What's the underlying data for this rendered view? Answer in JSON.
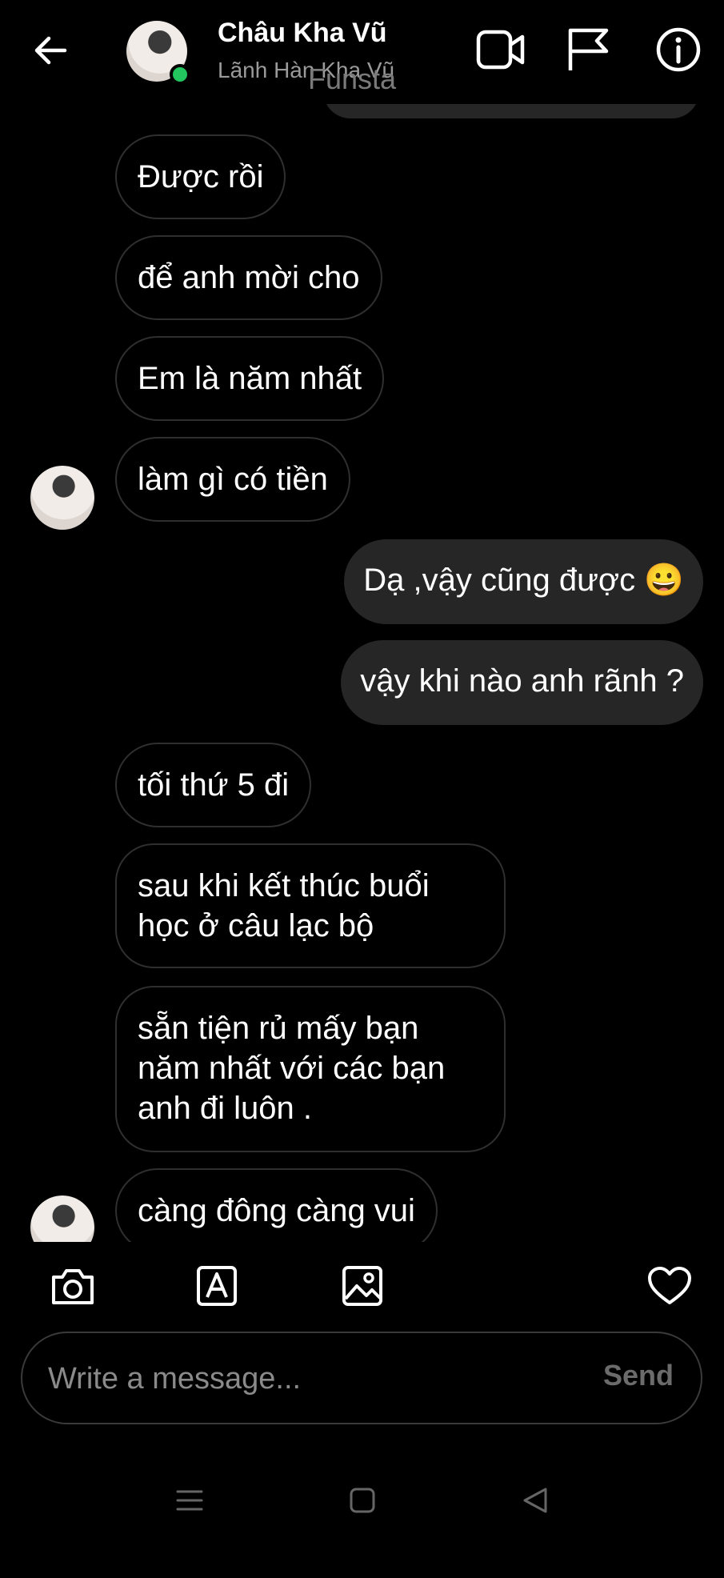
{
  "header": {
    "contact_name": "Châu Kha Vũ",
    "contact_subtitle": "Lãnh Hàn Kha Vũ",
    "peek_text": "Funsta",
    "icons": [
      "back-arrow-icon",
      "video-call-icon",
      "flag-icon",
      "info-icon"
    ],
    "online_color": "#22c55e"
  },
  "messages": [
    {
      "side": "in",
      "text": "Được rồi"
    },
    {
      "side": "in",
      "text": "để anh mời cho"
    },
    {
      "side": "in",
      "text": "Em là năm nhất"
    },
    {
      "side": "in",
      "text": "làm gì có tiền"
    },
    {
      "side": "out",
      "text": "Dạ ,vậy cũng được 😀"
    },
    {
      "side": "out",
      "text": "vậy khi nào anh rãnh ?"
    },
    {
      "side": "in",
      "text": "tối thứ 5 đi"
    },
    {
      "side": "in",
      "text": "sau khi kết thúc buổi học ở câu lạc bộ"
    },
    {
      "side": "in",
      "text": "sẵn tiện rủ mấy bạn năm nhất với các bạn anh đi luôn ."
    },
    {
      "side": "in",
      "text": "càng đông càng vui"
    }
  ],
  "toolbar": {
    "icons": [
      "camera-icon",
      "text-style-icon",
      "gallery-icon",
      "heart-icon"
    ]
  },
  "composer": {
    "placeholder": "Write a message...",
    "send_label": "Send"
  },
  "navbar": {
    "icons": [
      "menu-icon",
      "home-icon",
      "back-nav-icon"
    ]
  },
  "colors": {
    "background": "#000000",
    "outgoing_bubble": "#262626",
    "incoming_border": "#2f2f2f",
    "muted_text": "#9a9a9a"
  }
}
